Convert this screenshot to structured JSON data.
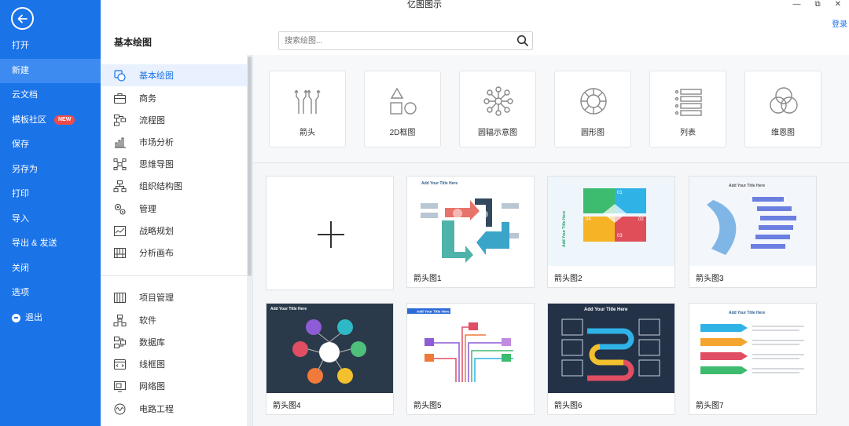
{
  "window": {
    "title": "亿图图示",
    "login": "登录",
    "controls": [
      "—",
      "⧉",
      "✕"
    ]
  },
  "left_menu": {
    "items": [
      {
        "label": "打开",
        "active": false
      },
      {
        "label": "新建",
        "active": true
      },
      {
        "label": "云文档",
        "active": false
      },
      {
        "label": "模板社区",
        "active": false,
        "badge": "NEW"
      },
      {
        "label": "保存",
        "active": false
      },
      {
        "label": "另存为",
        "active": false
      },
      {
        "label": "打印",
        "active": false
      },
      {
        "label": "导入",
        "active": false
      },
      {
        "label": "导出 & 发送",
        "active": false
      },
      {
        "label": "关闭",
        "active": false
      },
      {
        "label": "选项",
        "active": false
      },
      {
        "label": "退出",
        "active": false,
        "icon": "exit-icon"
      }
    ]
  },
  "header": {
    "section_title": "基本绘图",
    "search_placeholder": "搜索绘图..."
  },
  "categories": {
    "group1": [
      {
        "label": "基本绘图",
        "icon": "basic-shapes-icon",
        "active": true
      },
      {
        "label": "商务",
        "icon": "briefcase-icon"
      },
      {
        "label": "流程图",
        "icon": "flowchart-icon"
      },
      {
        "label": "市场分析",
        "icon": "bar-chart-icon"
      },
      {
        "label": "思维导图",
        "icon": "mindmap-icon"
      },
      {
        "label": "组织结构图",
        "icon": "org-chart-icon"
      },
      {
        "label": "管理",
        "icon": "gears-icon"
      },
      {
        "label": "战略规划",
        "icon": "line-chart-icon"
      },
      {
        "label": "分析画布",
        "icon": "canvas-icon"
      }
    ],
    "group2": [
      {
        "label": "项目管理",
        "icon": "gantt-icon"
      },
      {
        "label": "软件",
        "icon": "software-icon"
      },
      {
        "label": "数据库",
        "icon": "database-icon"
      },
      {
        "label": "线框图",
        "icon": "wireframe-icon"
      },
      {
        "label": "网络图",
        "icon": "network-icon"
      },
      {
        "label": "电路工程",
        "icon": "circuit-icon"
      }
    ]
  },
  "shapes": [
    {
      "label": "箭头",
      "icon": "arrows-icon"
    },
    {
      "label": "2D框图",
      "icon": "2d-shapes-icon"
    },
    {
      "label": "圆辐示意图",
      "icon": "radial-icon"
    },
    {
      "label": "圆形图",
      "icon": "circle-diagram-icon"
    },
    {
      "label": "列表",
      "icon": "list-icon"
    },
    {
      "label": "维恩图",
      "icon": "venn-icon"
    }
  ],
  "templates": [
    {
      "label": "",
      "kind": "new-blank"
    },
    {
      "label": "箭头图1",
      "thumb_title": "Add Your Title Here"
    },
    {
      "label": "箭头图2",
      "thumb_title": "Add Your Title Here"
    },
    {
      "label": "箭头图3",
      "thumb_title": "Add Your Title Here"
    },
    {
      "label": "箭头图4",
      "thumb_title": "Add Your Title Here"
    },
    {
      "label": "箭头图5",
      "thumb_title": "Add Your Title Here"
    },
    {
      "label": "箭头图6",
      "thumb_title": "Add Your Title Here"
    },
    {
      "label": "箭头图7",
      "thumb_title": "Add Your Title Here"
    }
  ],
  "colors": {
    "primary": "#1b73e8",
    "badge": "#ef4b4b"
  }
}
